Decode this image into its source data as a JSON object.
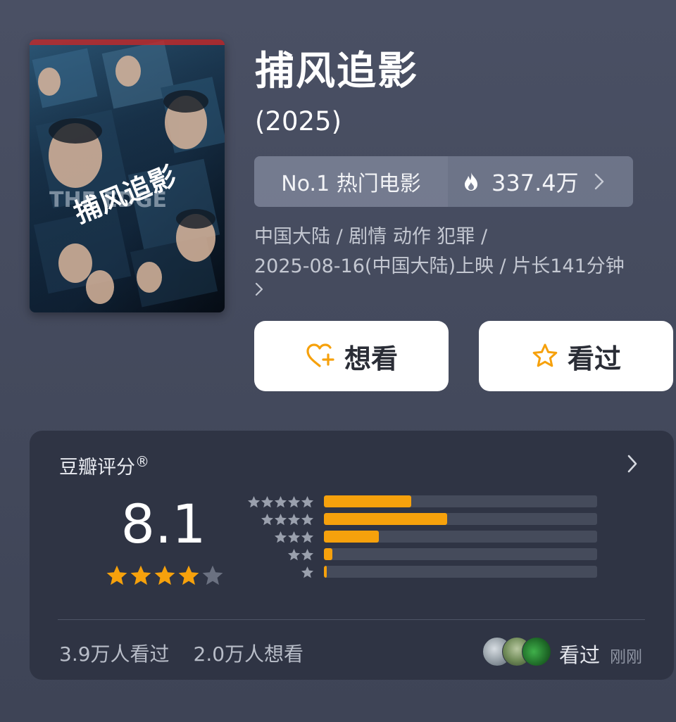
{
  "movie": {
    "title": "捕风追影",
    "year": "(2025)",
    "rank_label": "No.1 热门电影",
    "heat": "337.4万",
    "meta_line1": "中国大陆 / 剧情 动作 犯罪 /",
    "meta_line2": "2025-08-16(中国大陆)上映 / 片长141分钟",
    "poster_text": "THE EDGE",
    "poster_title_text": "捕风追影"
  },
  "actions": {
    "want_label": "想看",
    "seen_label": "看过"
  },
  "rating": {
    "title": "豆瓣评分",
    "mark": "®",
    "score": "8.1",
    "stars": 4,
    "distribution": [
      {
        "stars": 5,
        "fraction": 0.32
      },
      {
        "stars": 4,
        "fraction": 0.45
      },
      {
        "stars": 3,
        "fraction": 0.2
      },
      {
        "stars": 2,
        "fraction": 0.03
      },
      {
        "stars": 1,
        "fraction": 0.01
      }
    ],
    "watched": "3.9万人看过",
    "wanted": "2.0万人想看",
    "friend_action": "看过",
    "friend_time": "刚刚"
  },
  "colors": {
    "accent": "#f6a10c",
    "background": "#474d60",
    "card": "#2f3444"
  },
  "icons": {
    "heat": "flame-icon",
    "want": "heart-plus-icon",
    "seen": "star-outline-icon",
    "more": "chevron-right-icon"
  }
}
